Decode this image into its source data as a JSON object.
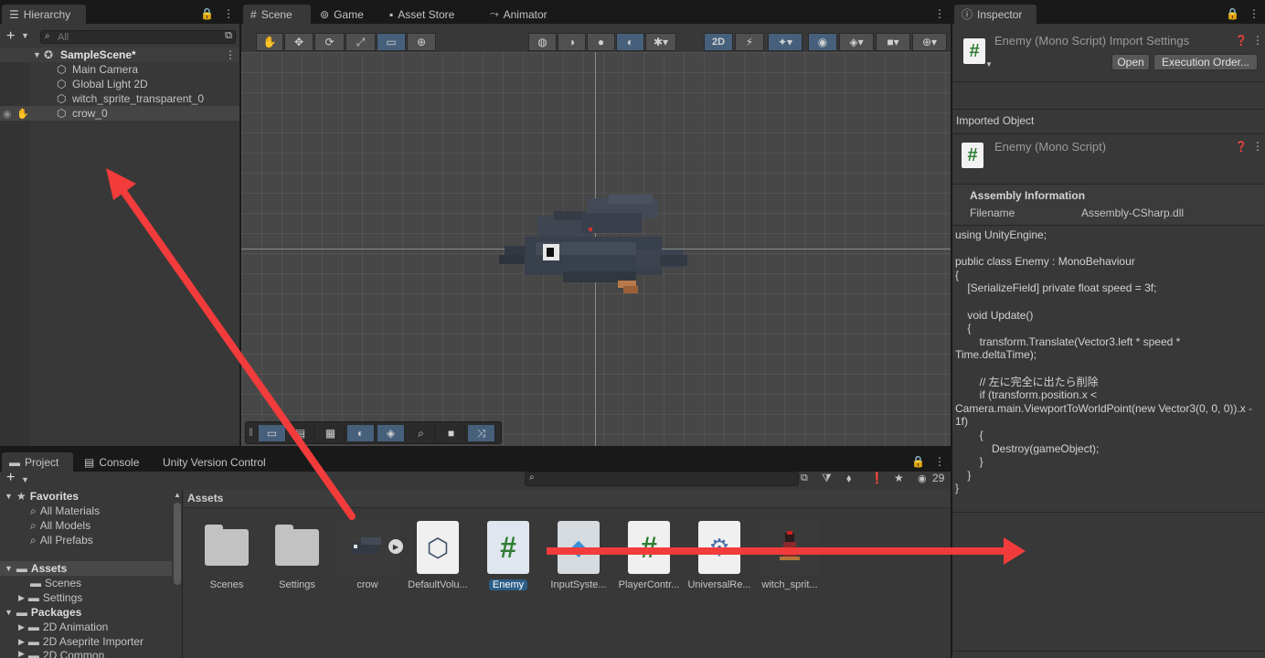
{
  "hierarchy": {
    "tab": "Hierarchy",
    "search_placeholder": "All",
    "scene": "SampleScene*",
    "items": [
      "Main Camera",
      "Global Light 2D",
      "witch_sprite_transparent_0",
      "crow_0"
    ]
  },
  "scene_tabs": [
    "Scene",
    "Game",
    "Asset Store",
    "Animator"
  ],
  "scene_toolbar": {
    "mode_2d": "2D"
  },
  "inspector": {
    "tab": "Inspector",
    "title": "Enemy (Mono Script) Import Settings",
    "open_label": "Open",
    "exec_order_label": "Execution Order...",
    "imported_object": "Imported Object",
    "obj_title": "Enemy (Mono Script)",
    "assembly_info": "Assembly Information",
    "filename_label": "Filename",
    "filename_value": "Assembly-CSharp.dll",
    "code": "using UnityEngine;\n\npublic class Enemy : MonoBehaviour\n{\n    [SerializeField] private float speed = 3f;\n\n    void Update()\n    {\n        transform.Translate(Vector3.left * speed * Time.deltaTime);\n\n        // 左に完全に出たら削除\n        if (transform.position.x < Camera.main.ViewportToWorldPoint(new Vector3(0, 0, 0)).x - 1f)\n        {\n            Destroy(gameObject);\n        }\n    }\n}"
  },
  "project": {
    "tabs": [
      "Project",
      "Console",
      "Unity Version Control"
    ],
    "count": "29",
    "favorites": "Favorites",
    "fav_items": [
      "All Materials",
      "All Models",
      "All Prefabs"
    ],
    "assets_label": "Assets",
    "asset_children": [
      "Scenes",
      "Settings"
    ],
    "packages": "Packages",
    "package_items": [
      "2D Animation",
      "2D Aseprite Importer",
      "2D Common"
    ],
    "breadcrumb": "Assets",
    "assets": [
      "Scenes",
      "Settings",
      "crow",
      "DefaultVolu...",
      "Enemy",
      "InputSyste...",
      "PlayerContr...",
      "UniversalRe...",
      "witch_sprit..."
    ]
  },
  "colors": {
    "accent": "#46607c",
    "selection": "#2c5d87",
    "arrow": "#f23b3b"
  }
}
